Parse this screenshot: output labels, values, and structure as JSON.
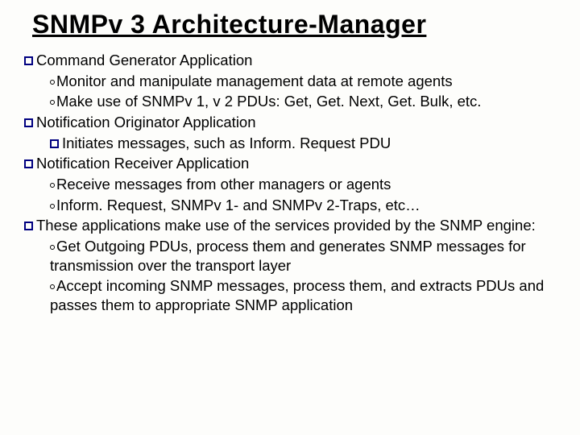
{
  "title": "SNMPv 3 Architecture-Manager",
  "l1a": "Command Generator Application",
  "l1a_s1": "Monitor and manipulate management data at remote agents",
  "l1a_s2": "Make use of SNMPv 1, v 2 PDUs: Get, Get. Next, Get. Bulk, etc.",
  "l1b": "Notification Originator Application",
  "l1b_s1": "Initiates messages, such as Inform. Request PDU",
  "l1c": "Notification Receiver Application",
  "l1c_s1": "Receive messages from other managers or agents",
  "l1c_s2": "Inform. Request, SNMPv 1- and SNMPv 2-Traps, etc…",
  "l1d": "These applications make use of the services provided by the SNMP engine:",
  "l1d_s1": "Get Outgoing PDUs, process them and generates SNMP messages for transmission over the transport layer",
  "l1d_s2": "Accept incoming SNMP messages, process them, and extracts PDUs  and passes them to appropriate SNMP application"
}
